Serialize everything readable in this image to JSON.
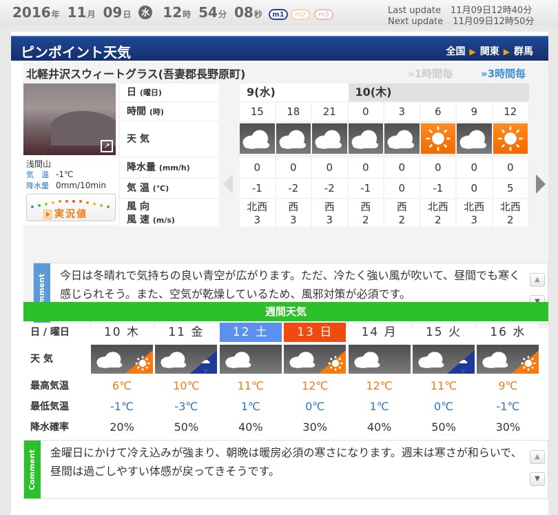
{
  "clock": {
    "year": "2016",
    "y": "年",
    "month": "11",
    "m": "月",
    "day": "09",
    "d": "日",
    "dow": "水",
    "hour": "12",
    "h": "時",
    "min": "54",
    "mi": "分",
    "sec": "08",
    "s": "秒"
  },
  "modes": [
    "m1",
    "m2",
    "m3"
  ],
  "update": {
    "last_label": "Last update",
    "last_value": "11月09日12時40分",
    "next_label": "Next update",
    "next_value": "11月09日12時50分"
  },
  "title": "ピンポイント天気",
  "breadcrumb": [
    "全国",
    "関東",
    "群馬"
  ],
  "location": "北軽井沢スウィートグラス(吾妻郡長野原町)",
  "toggles": {
    "hourly1": "1時間毎",
    "hourly3": "3時間毎"
  },
  "camera": {
    "name": "浅間山",
    "temp_label": "気　温",
    "temp_value": "-1℃",
    "rain_label": "降水量",
    "rain_value": "0mm/10min",
    "live_label": "実況値"
  },
  "rows": {
    "day": {
      "label": "日",
      "unit": "(曜日)"
    },
    "time": {
      "label": "時間",
      "unit": "(時)"
    },
    "weather": {
      "label": "天 気"
    },
    "rain": {
      "label": "降水量",
      "unit": "(mm/h)"
    },
    "temp": {
      "label": "気 温",
      "unit": "(℃)"
    },
    "wind": {
      "label1": "風 向",
      "label2": "風 速",
      "unit": "(m/s)"
    }
  },
  "days_header": [
    "9(水)",
    "10(木)"
  ],
  "hourly": {
    "times": [
      "15",
      "18",
      "21",
      "0",
      "3",
      "6",
      "9",
      "12"
    ],
    "weather_icons": [
      "cloud-icon",
      "cloud-icon",
      "cloud-icon",
      "cloud-icon",
      "cloud-icon",
      "sun-icon",
      "cloud-icon",
      "sun-icon"
    ],
    "rain": [
      "0",
      "0",
      "0",
      "0",
      "0",
      "0",
      "0",
      "0"
    ],
    "temp": [
      "-1",
      "-2",
      "-2",
      "-1",
      "0",
      "-1",
      "0",
      "5"
    ],
    "wind_dir": [
      "北西",
      "西",
      "西",
      "西",
      "西",
      "北西",
      "北西",
      "北西"
    ],
    "wind_speed": [
      "3",
      "3",
      "3",
      "2",
      "2",
      "2",
      "3",
      "2"
    ]
  },
  "comment1": {
    "tab": "Comment",
    "text": "今日は冬晴れで気持ちの良い青空が広がります。ただ、冷たく強い風が吹いて、昼間でも寒く感じられそう。また、空気が乾燥しているため、風邪対策が必須です。"
  },
  "weekly": {
    "title": "週間天気",
    "labels": {
      "day": "日 / 曜日",
      "weather": "天 気",
      "high": "最高気温",
      "low": "最低気温",
      "rain": "降水確率"
    },
    "days": [
      {
        "day": "10 木",
        "icon": "cloud-sun-icon",
        "high": "6℃",
        "low": "-1℃",
        "rain": "20%",
        "color": "#ffffff"
      },
      {
        "day": "11 金",
        "icon": "cloud-snow-icon",
        "high": "10℃",
        "low": "-3℃",
        "rain": "50%",
        "color": "#ffffff"
      },
      {
        "day": "12 土",
        "icon": "cloud-icon",
        "high": "11℃",
        "low": "1℃",
        "rain": "40%",
        "color": "#5b8ff0"
      },
      {
        "day": "13 日",
        "icon": "cloud-sun-icon",
        "high": "12℃",
        "low": "0℃",
        "rain": "30%",
        "color": "#f04a10"
      },
      {
        "day": "14 月",
        "icon": "cloud-icon",
        "high": "12℃",
        "low": "1℃",
        "rain": "40%",
        "color": "#ffffff"
      },
      {
        "day": "15 火",
        "icon": "cloud-snow-icon",
        "high": "11℃",
        "low": "0℃",
        "rain": "50%",
        "color": "#ffffff"
      },
      {
        "day": "16 水",
        "icon": "cloud-sun-icon",
        "high": "9℃",
        "low": "-1℃",
        "rain": "30%",
        "color": "#ffffff"
      }
    ]
  },
  "comment2": {
    "tab": "Comment",
    "text": "金曜日にかけて冷え込みが強まり、朝晩は暖房必須の寒さになります。週末は寒さが和らいで、昼間は過ごしやすい体感が戻ってきそうです。"
  },
  "colors": {
    "navy": "#1a3a80",
    "green": "#2cc02a",
    "orange": "#f07a10",
    "blue": "#2f73c2",
    "comment_tab": "#5b9ad6"
  }
}
